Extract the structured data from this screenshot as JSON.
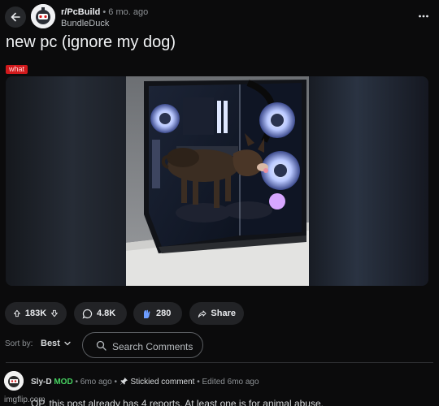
{
  "header": {
    "subreddit": "r/PcBuild",
    "age": "6 mo. ago",
    "username": "BundleDuck"
  },
  "post": {
    "title": "new pc (ignore my dog)",
    "flair": "what",
    "flair_color": "#d1191c"
  },
  "actions": {
    "upvotes": "183K",
    "comments": "4.8K",
    "awards": "280",
    "share": "Share"
  },
  "sort": {
    "label": "Sort by:",
    "value": "Best",
    "search_placeholder": "Search Comments"
  },
  "comment": {
    "author": "Sly-D",
    "mod_badge": "MOD",
    "age": "6mo ago",
    "stickied": "Stickied comment",
    "edited": "Edited 6mo ago",
    "body": "OP, this post already has 4 reports. At least one is for animal abuse."
  },
  "watermark": "imgflip.com",
  "colors": {
    "background": "#0b0b0c",
    "pill": "#222326",
    "mod_green": "#46d160",
    "award_blue": "#6d9dff"
  },
  "icons": [
    "back-arrow-icon",
    "more-icon",
    "upvote-icon",
    "downvote-icon",
    "comment-icon",
    "award-icon",
    "share-icon",
    "chevron-down-icon",
    "search-icon",
    "pin-icon"
  ]
}
